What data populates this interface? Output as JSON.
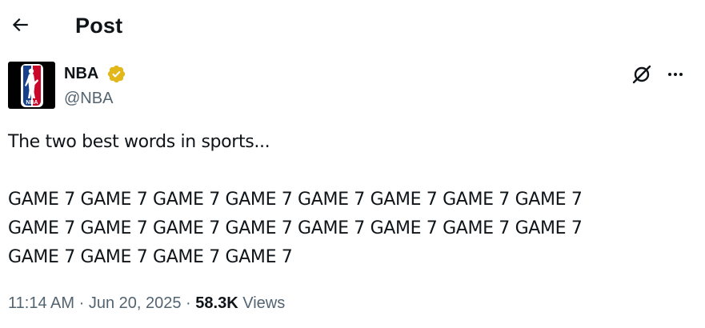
{
  "header": {
    "back_icon": "arrow-left-icon",
    "title": "Post"
  },
  "author": {
    "name": "NBA",
    "handle": "@NBA",
    "verified": true,
    "verified_color": "#e2b719",
    "avatar_logo_text": "NBA",
    "avatar_colors": {
      "blue": "#17408b",
      "red": "#c9082a",
      "background": "#000000"
    }
  },
  "actions": {
    "grok_icon": "grok-icon",
    "more_icon": "more-horizontal-icon"
  },
  "post": {
    "text": "The two best words in sports...\n\nGAME 7 GAME 7 GAME 7 GAME 7 GAME 7 GAME 7 GAME 7 GAME 7\nGAME 7 GAME 7 GAME 7 GAME 7 GAME 7 GAME 7 GAME 7 GAME 7\nGAME 7 GAME 7 GAME 7 GAME 7",
    "time": "11:14 AM",
    "separator": "·",
    "date": "Jun 20, 2025",
    "views_count": "58.3K",
    "views_label": "Views"
  },
  "colors": {
    "text_primary": "#0f1419",
    "text_secondary": "#536471"
  }
}
